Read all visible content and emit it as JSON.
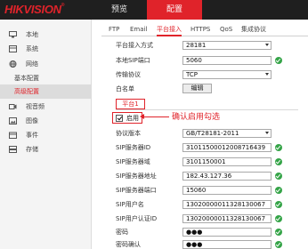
{
  "brand": {
    "logo_text": "HIKVISION",
    "reg_mark": "®"
  },
  "nav": {
    "preview": "预览",
    "config": "配置"
  },
  "sidebar": {
    "items": [
      {
        "label": "本地",
        "icon": "monitor-icon"
      },
      {
        "label": "系统",
        "icon": "system-icon"
      },
      {
        "label": "网络",
        "icon": "globe-icon"
      },
      {
        "label": "基本配置"
      },
      {
        "label": "高级配置"
      },
      {
        "label": "视音频",
        "icon": "video-icon"
      },
      {
        "label": "图像",
        "icon": "image-icon"
      },
      {
        "label": "事件",
        "icon": "calendar-icon"
      },
      {
        "label": "存储",
        "icon": "storage-icon"
      }
    ]
  },
  "tabs": [
    "FTP",
    "Email",
    "平台接入",
    "HTTPS",
    "QoS",
    "集成协议"
  ],
  "form": {
    "access_mode": {
      "label": "平台接入方式",
      "value": "28181"
    },
    "local_sip_port": {
      "label": "本地SIP端口",
      "value": "5060"
    },
    "transport": {
      "label": "传输协议",
      "value": "TCP"
    },
    "whitelist": {
      "label": "白名单",
      "button": "编辑"
    },
    "platform_tab": "平台1",
    "enable": {
      "label": "启用"
    },
    "callout": "确认启用勾选",
    "protocol_version": {
      "label": "协议版本",
      "value": "GB/T28181-2011"
    },
    "sip_server_id": {
      "label": "SIP服务器ID",
      "value": "31011500012008716439"
    },
    "sip_server_domain": {
      "label": "SIP服务器域",
      "value": "3101150001"
    },
    "sip_server_addr": {
      "label": "SIP服务器地址",
      "value": "182.43.127.36"
    },
    "sip_server_port": {
      "label": "SIP服务器端口",
      "value": "15060"
    },
    "sip_user": {
      "label": "SIP用户名",
      "value": "13020000011328130067"
    },
    "sip_user_auth": {
      "label": "SIP用户认证ID",
      "value": "13020000011328130067"
    },
    "password": {
      "label": "密码",
      "value": "●●●"
    },
    "password_confirm": {
      "label": "密码确认",
      "value": "●●●"
    }
  },
  "colors": {
    "accent": "#e0232a",
    "ok": "#35a448",
    "topbar": "#1f1f1f"
  }
}
